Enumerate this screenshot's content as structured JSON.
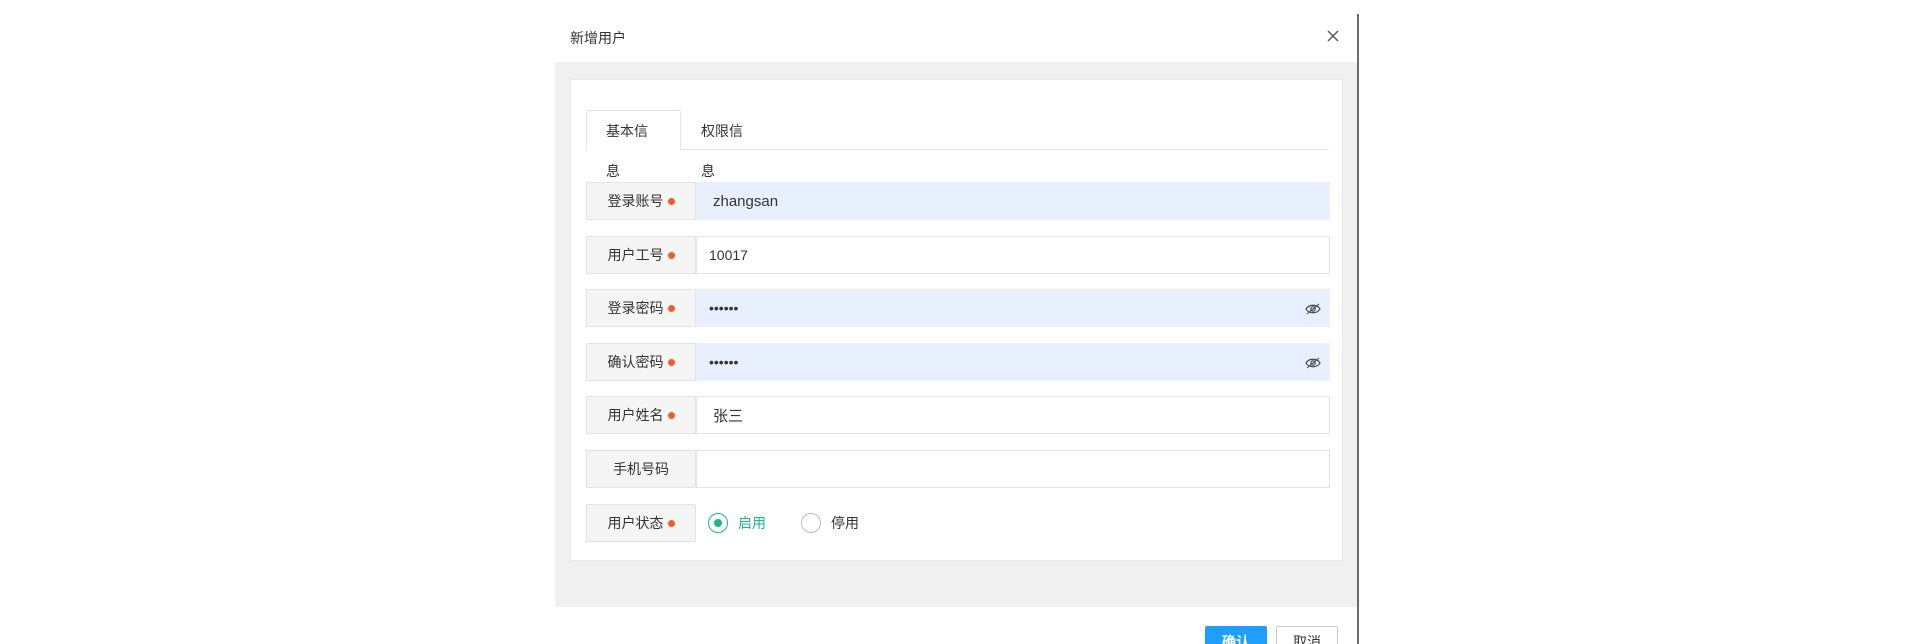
{
  "dialog": {
    "title": "新增用户"
  },
  "tabs": [
    {
      "label": "基本信息",
      "active": true
    },
    {
      "label": "权限信息",
      "active": false
    }
  ],
  "form": {
    "login_account": {
      "label": "登录账号",
      "value": "zhangsan",
      "required": true
    },
    "employee_no": {
      "label": "用户工号",
      "value": "10017",
      "required": true
    },
    "password": {
      "label": "登录密码",
      "value": "••••••",
      "required": true
    },
    "confirm_password": {
      "label": "确认密码",
      "value": "••••••",
      "required": true
    },
    "user_name": {
      "label": "用户姓名",
      "value": "张三",
      "required": true
    },
    "phone": {
      "label": "手机号码",
      "value": "",
      "required": false
    },
    "status": {
      "label": "用户状态",
      "required": true,
      "options": [
        {
          "label": "启用",
          "checked": true
        },
        {
          "label": "停用",
          "checked": false
        }
      ]
    }
  },
  "footer": {
    "confirm_label": "确认",
    "cancel_label": "取消"
  },
  "colors": {
    "accent_green": "#19b68f",
    "primary_blue": "#1e9fff",
    "required_dot": "#f45b2a",
    "autofill_bg": "#e8f0fe"
  },
  "icons": {
    "close": "close-icon",
    "eye": "eye-icon"
  }
}
